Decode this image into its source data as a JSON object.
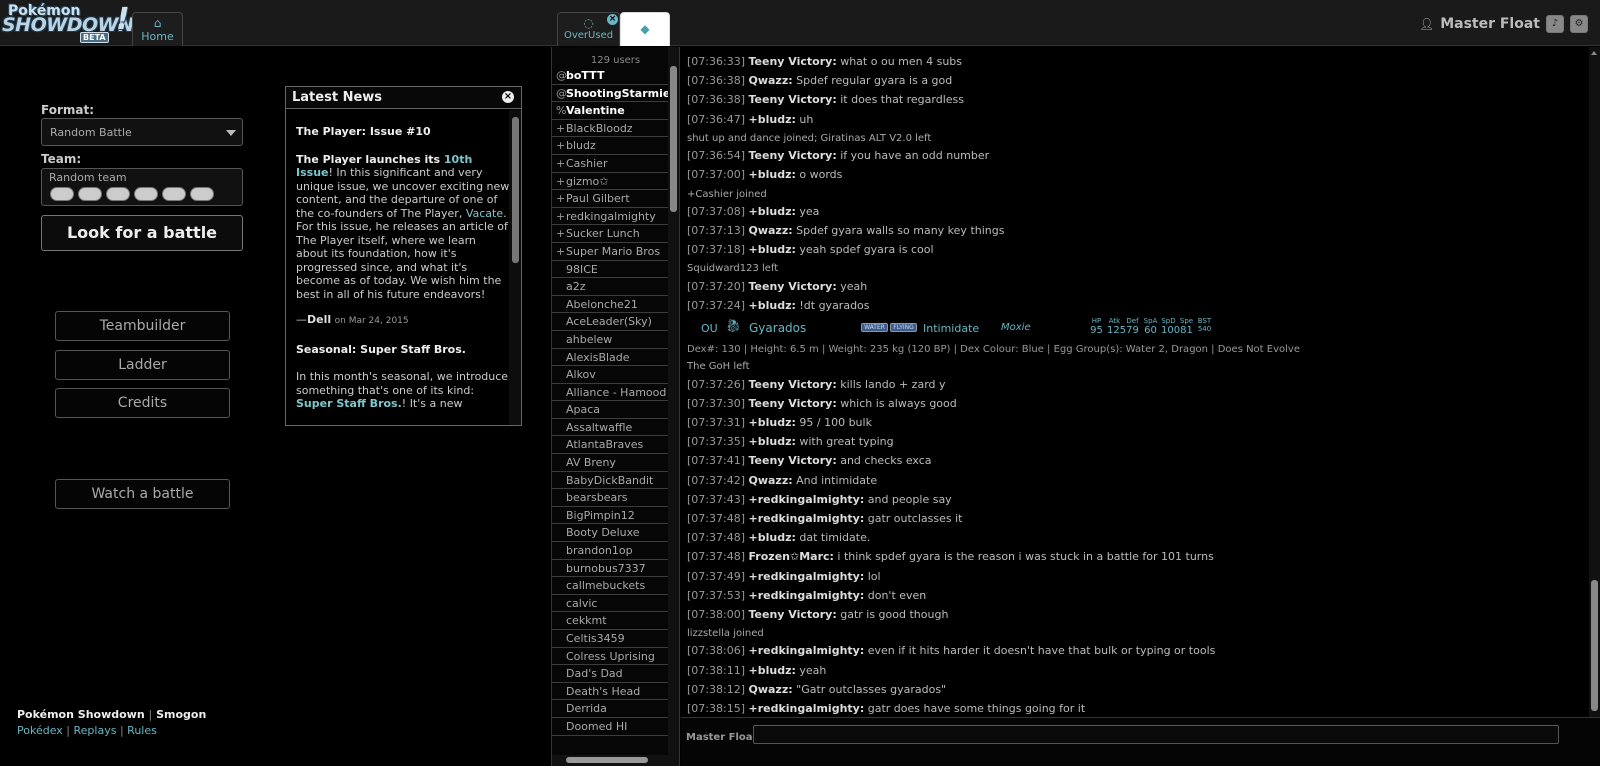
{
  "header": {
    "logo": {
      "line1": "Pokémon",
      "line2": "SHOWDOWN",
      "beta": "BETA",
      "bang": "!"
    },
    "tabs": [
      {
        "icon": "home-icon",
        "label": "Home"
      },
      {
        "icon": "chat-bubble-icon",
        "label": "OverUsed"
      },
      {
        "icon": "diamond-icon",
        "label": ""
      }
    ],
    "username": "Master Float"
  },
  "mainmenu": {
    "format_label": "Format:",
    "format_value": "Random Battle",
    "team_label": "Team:",
    "team_value": "Random team",
    "look_battle": "Look for a battle",
    "buttons": [
      "Teambuilder",
      "Ladder",
      "Credits"
    ],
    "watch": "Watch a battle"
  },
  "news": {
    "title": "Latest News",
    "item1_title": "The Player: Issue #10",
    "item1_p1": "The Player launches its ",
    "item1_link1": "10th Issue",
    "item1_p2": "! In this significant and very unique issue, we uncover exciting new content, and the departure of one of the co-founders of The Player, ",
    "item1_link2": "Vacate",
    "item1_p3": ". For this issue, he releases an article of The Player itself, where we learn about its foundation, how it's progressed since, and what it's become as of today. We wish him the best in all of his future endeavors!",
    "item1_author": "Dell",
    "item1_date": "on Mar 24, 2015",
    "item2_title": "Seasonal: Super Staff Bros.",
    "item2_p1": "In this month's seasonal, we introduce something that's one of its kind: ",
    "item2_link": "Super Staff Bros.",
    "item2_p2": "! It's a new"
  },
  "footer": {
    "site": "Pokémon Showdown",
    "smogon": "Smogon",
    "links": [
      "Pokédex",
      "Replays",
      "Rules"
    ]
  },
  "userlist": {
    "count": "129 users",
    "users": [
      {
        "g": "@",
        "n": "boTTT",
        "auth": true
      },
      {
        "g": "@",
        "n": "ShootingStarmie",
        "auth": true
      },
      {
        "g": "%",
        "n": "Valentine",
        "auth": true
      },
      {
        "g": "+",
        "n": "BlackBloodz",
        "auth": false
      },
      {
        "g": "+",
        "n": "bludz",
        "auth": false
      },
      {
        "g": "+",
        "n": "Cashier",
        "auth": false
      },
      {
        "g": "+",
        "n": "gizmo✩",
        "auth": false
      },
      {
        "g": "+",
        "n": "Paul Gilbert",
        "auth": false
      },
      {
        "g": "+",
        "n": "redkingalmighty",
        "auth": false
      },
      {
        "g": "+",
        "n": "Sucker Lunch",
        "auth": false
      },
      {
        "g": "+",
        "n": "Super Mario Bros",
        "auth": false
      },
      {
        "g": "",
        "n": "98ICE",
        "auth": false
      },
      {
        "g": "",
        "n": "a2z",
        "auth": false
      },
      {
        "g": "",
        "n": "Abelonche21",
        "auth": false
      },
      {
        "g": "",
        "n": "AceLeader(Sky)",
        "auth": false
      },
      {
        "g": "",
        "n": "ahbelew",
        "auth": false
      },
      {
        "g": "",
        "n": "AlexisBlade",
        "auth": false
      },
      {
        "g": "",
        "n": "Alkov",
        "auth": false
      },
      {
        "g": "",
        "n": "Alliance - Hamood",
        "auth": false
      },
      {
        "g": "",
        "n": "Apaca",
        "auth": false
      },
      {
        "g": "",
        "n": "Assaltwaffle",
        "auth": false
      },
      {
        "g": "",
        "n": "AtlantaBraves",
        "auth": false
      },
      {
        "g": "",
        "n": "AV Breny",
        "auth": false
      },
      {
        "g": "",
        "n": "BabyDickBandit",
        "auth": false
      },
      {
        "g": "",
        "n": "bearsbears",
        "auth": false
      },
      {
        "g": "",
        "n": "BigPimpin12",
        "auth": false
      },
      {
        "g": "",
        "n": "Booty Deluxe",
        "auth": false
      },
      {
        "g": "",
        "n": "brandon1op",
        "auth": false
      },
      {
        "g": "",
        "n": "burnobus7337",
        "auth": false
      },
      {
        "g": "",
        "n": "callmebuckets",
        "auth": false
      },
      {
        "g": "",
        "n": "calvic",
        "auth": false
      },
      {
        "g": "",
        "n": "cekkmt",
        "auth": false
      },
      {
        "g": "",
        "n": "Celtis3459",
        "auth": false
      },
      {
        "g": "",
        "n": "Colress Uprising",
        "auth": false
      },
      {
        "g": "",
        "n": "Dad's Dad",
        "auth": false
      },
      {
        "g": "",
        "n": "Death's Head",
        "auth": false
      },
      {
        "g": "",
        "n": "Derrida",
        "auth": false
      },
      {
        "g": "",
        "n": "Doomed HI",
        "auth": false
      }
    ]
  },
  "chat": {
    "lines": [
      {
        "t": "msg",
        "ts": "[07:36:33]",
        "u": "Teeny Victory:",
        "m": "what o ou men 4 subs"
      },
      {
        "t": "msg",
        "ts": "[07:36:38]",
        "u": "Qwazz:",
        "m": "Spdef regular gyara is a god"
      },
      {
        "t": "msg",
        "ts": "[07:36:38]",
        "u": "Teeny Victory:",
        "m": "it does that regardless"
      },
      {
        "t": "msg",
        "ts": "[07:36:47]",
        "u": "+bludz:",
        "m": "uh"
      },
      {
        "t": "note",
        "m": "shut up and dance joined; Giratinas ALT V2.0 left"
      },
      {
        "t": "msg",
        "ts": "[07:36:54]",
        "u": "Teeny Victory:",
        "m": "if you have an odd number"
      },
      {
        "t": "msg",
        "ts": "[07:37:00]",
        "u": "+bludz:",
        "m": "o words"
      },
      {
        "t": "note",
        "m": "+Cashier joined"
      },
      {
        "t": "msg",
        "ts": "[07:37:08]",
        "u": "+bludz:",
        "m": "yea"
      },
      {
        "t": "msg",
        "ts": "[07:37:13]",
        "u": "Qwazz:",
        "m": "Spdef gyara walls so many key things"
      },
      {
        "t": "msg",
        "ts": "[07:37:18]",
        "u": "+bludz:",
        "m": "yeah spdef gyara is cool"
      },
      {
        "t": "note",
        "m": "Squidward123 left"
      },
      {
        "t": "msg",
        "ts": "[07:37:20]",
        "u": "Teeny Victory:",
        "m": "yeah"
      },
      {
        "t": "msg",
        "ts": "[07:37:24]",
        "u": "+bludz:",
        "m": "!dt gyarados"
      }
    ],
    "dex": {
      "tier": "OU",
      "name": "Gyarados",
      "types": [
        "WATER",
        "FLYING"
      ],
      "ability": "Intimidate",
      "hidden_ability": "Moxie",
      "stat_heads": [
        "HP",
        "Atk",
        "Def",
        "SpA",
        "SpD",
        "Spe",
        "BST"
      ],
      "stat_vals": [
        "95",
        "125",
        "79",
        "60",
        "100",
        "81",
        "540"
      ],
      "info": "Dex#: 130 | Height: 6.5 m | Weight: 235 kg (120 BP) | Dex Colour: Blue | Egg Group(s): Water 2, Dragon | Does Not Evolve"
    },
    "lines2": [
      {
        "t": "note",
        "m": "The GoH left"
      },
      {
        "t": "msg",
        "ts": "[07:37:26]",
        "u": "Teeny Victory:",
        "m": "kills lando + zard y"
      },
      {
        "t": "msg",
        "ts": "[07:37:30]",
        "u": "Teeny Victory:",
        "m": "which is always good"
      },
      {
        "t": "msg",
        "ts": "[07:37:31]",
        "u": "+bludz:",
        "m": "95 / 100 bulk"
      },
      {
        "t": "msg",
        "ts": "[07:37:35]",
        "u": "+bludz:",
        "m": "with great typing"
      },
      {
        "t": "msg",
        "ts": "[07:37:41]",
        "u": "Teeny Victory:",
        "m": "and checks exca"
      },
      {
        "t": "msg",
        "ts": "[07:37:42]",
        "u": "Qwazz:",
        "m": "And intimidate"
      },
      {
        "t": "msg",
        "ts": "[07:37:43]",
        "u": "+redkingalmighty:",
        "m": "and people say"
      },
      {
        "t": "msg",
        "ts": "[07:37:48]",
        "u": "+redkingalmighty:",
        "m": "gatr outclasses it"
      },
      {
        "t": "msg",
        "ts": "[07:37:48]",
        "u": "+bludz:",
        "m": "dat timidate."
      },
      {
        "t": "msg",
        "ts": "[07:37:48]",
        "u": "Frozen✩Marc:",
        "m": "i think spdef gyara is the reason i was stuck in a battle for 101 turns"
      },
      {
        "t": "msg",
        "ts": "[07:37:49]",
        "u": "+redkingalmighty:",
        "m": "lol"
      },
      {
        "t": "msg",
        "ts": "[07:37:53]",
        "u": "+redkingalmighty:",
        "m": "don't even"
      },
      {
        "t": "msg",
        "ts": "[07:38:00]",
        "u": "Teeny Victory:",
        "m": "gatr is good though"
      },
      {
        "t": "note",
        "m": "lizzstella joined"
      },
      {
        "t": "msg",
        "ts": "[07:38:06]",
        "u": "+redkingalmighty:",
        "m": "even if it hits harder it doesn't have that bulk or typing or tools"
      },
      {
        "t": "msg",
        "ts": "[07:38:11]",
        "u": "+bludz:",
        "m": "yeah"
      },
      {
        "t": "msg",
        "ts": "[07:38:12]",
        "u": "Qwazz:",
        "m": "\"Gatr outclasses gyarados\""
      },
      {
        "t": "msg",
        "ts": "[07:38:15]",
        "u": "+redkingalmighty:",
        "m": "gatr does have some things going for it"
      }
    ],
    "input_name": "Master Floa",
    "input_value": ""
  }
}
